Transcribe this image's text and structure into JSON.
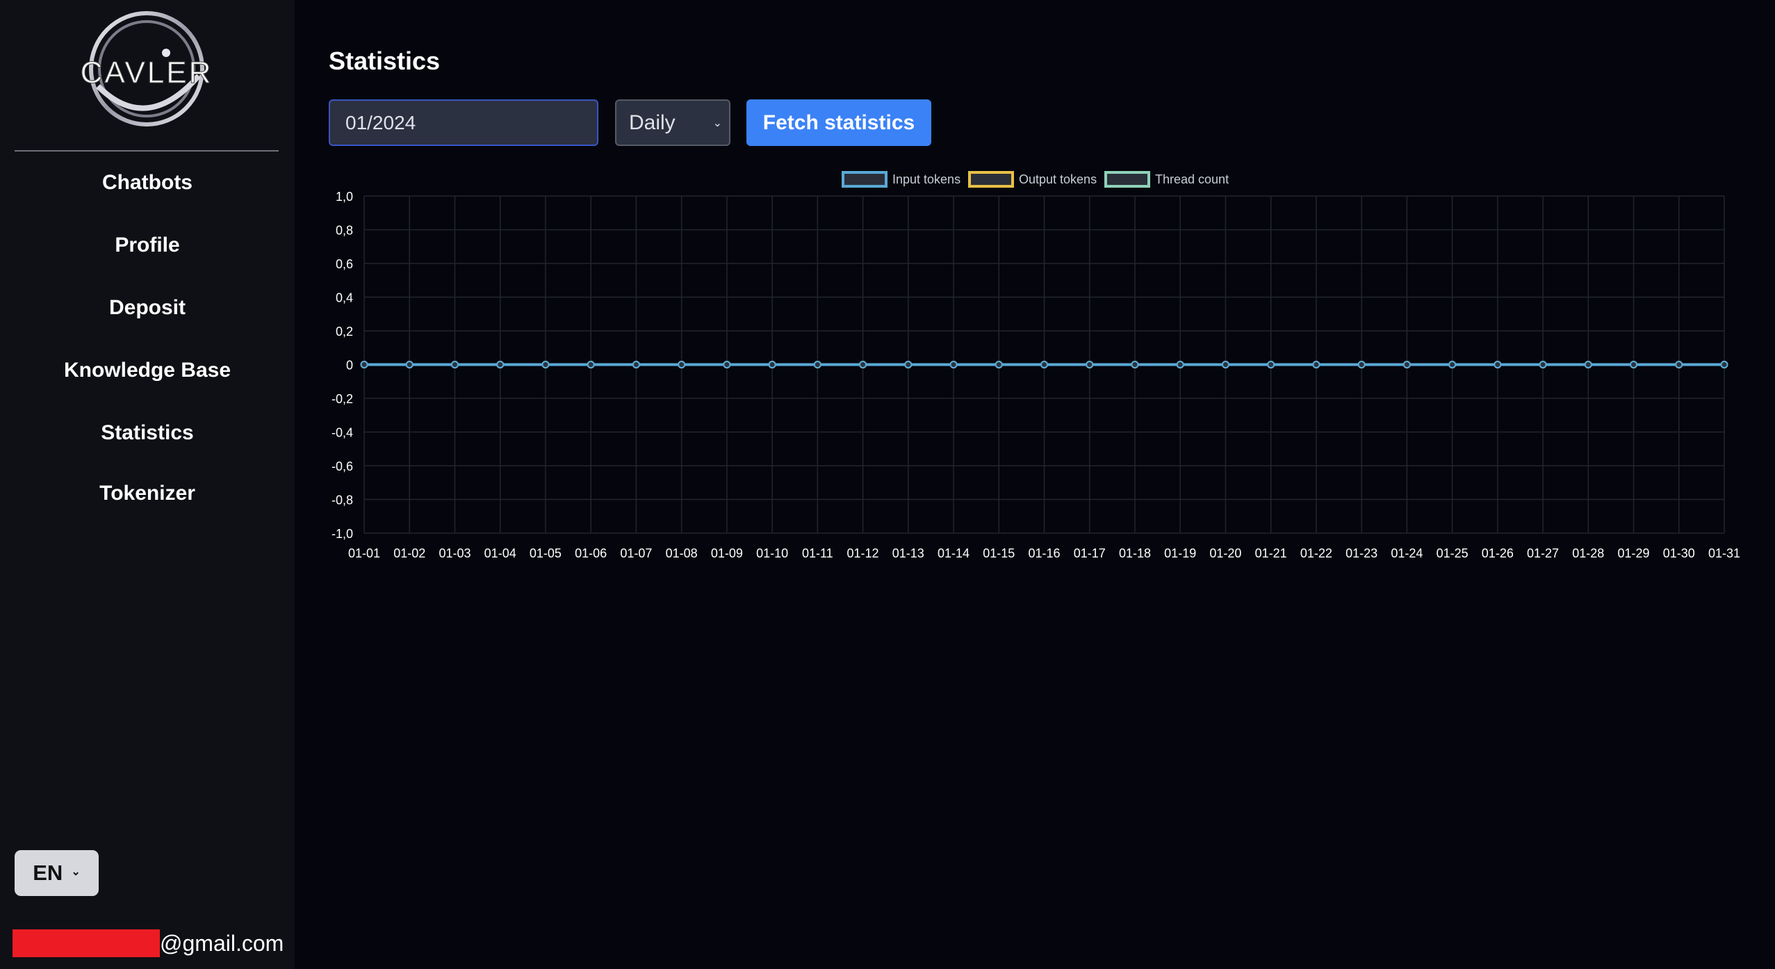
{
  "sidebar": {
    "logo_text": "CAVLER",
    "items": [
      {
        "label": "Chatbots"
      },
      {
        "label": "Profile"
      },
      {
        "label": "Deposit"
      },
      {
        "label": "Knowledge Base"
      },
      {
        "label": "Statistics"
      },
      {
        "label": "Tokenizer"
      }
    ],
    "language": "EN",
    "email_suffix": "@gmail.com"
  },
  "main": {
    "title": "Statistics",
    "date_input": {
      "value": "01/2024"
    },
    "period_select": {
      "selected": "Daily"
    },
    "fetch_button": "Fetch statistics"
  },
  "colors": {
    "accent": "#3b82f6",
    "input_tokens": "#5aa9d6",
    "output_tokens": "#e9c046",
    "thread_count": "#8fd1b8"
  },
  "chart_data": {
    "type": "line",
    "categories": [
      "01-01",
      "01-02",
      "01-03",
      "01-04",
      "01-05",
      "01-06",
      "01-07",
      "01-08",
      "01-09",
      "01-10",
      "01-11",
      "01-12",
      "01-13",
      "01-14",
      "01-15",
      "01-16",
      "01-17",
      "01-18",
      "01-19",
      "01-20",
      "01-21",
      "01-22",
      "01-23",
      "01-24",
      "01-25",
      "01-26",
      "01-27",
      "01-28",
      "01-29",
      "01-30",
      "01-31"
    ],
    "series": [
      {
        "name": "Input tokens",
        "values": [
          0,
          0,
          0,
          0,
          0,
          0,
          0,
          0,
          0,
          0,
          0,
          0,
          0,
          0,
          0,
          0,
          0,
          0,
          0,
          0,
          0,
          0,
          0,
          0,
          0,
          0,
          0,
          0,
          0,
          0,
          0
        ]
      },
      {
        "name": "Output tokens",
        "values": [
          0,
          0,
          0,
          0,
          0,
          0,
          0,
          0,
          0,
          0,
          0,
          0,
          0,
          0,
          0,
          0,
          0,
          0,
          0,
          0,
          0,
          0,
          0,
          0,
          0,
          0,
          0,
          0,
          0,
          0,
          0
        ]
      },
      {
        "name": "Thread count",
        "values": [
          0,
          0,
          0,
          0,
          0,
          0,
          0,
          0,
          0,
          0,
          0,
          0,
          0,
          0,
          0,
          0,
          0,
          0,
          0,
          0,
          0,
          0,
          0,
          0,
          0,
          0,
          0,
          0,
          0,
          0,
          0
        ]
      }
    ],
    "yticks": [
      "1,0",
      "0,8",
      "0,6",
      "0,4",
      "0,2",
      "0",
      "-0,2",
      "-0,4",
      "-0,6",
      "-0,8",
      "-1,0"
    ],
    "ylim": [
      -1,
      1
    ],
    "grid": true,
    "legend": "top-center"
  }
}
